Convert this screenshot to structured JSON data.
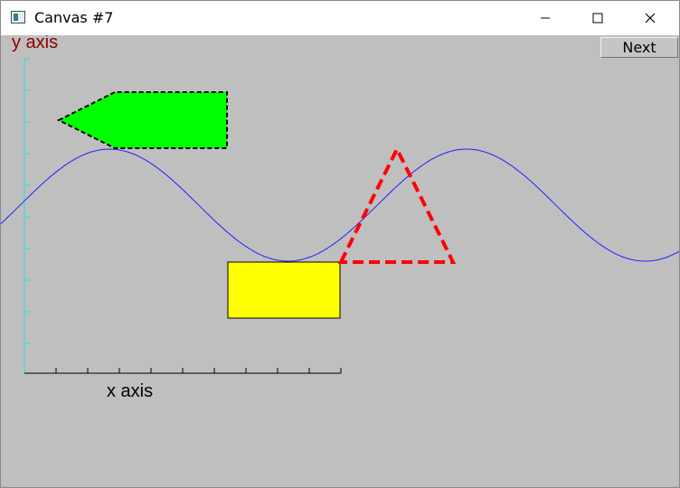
{
  "window": {
    "title": "Canvas #7",
    "controls": {
      "minimize_icon": "minimize-icon",
      "maximize_icon": "maximize-icon",
      "close_icon": "close-icon"
    }
  },
  "toolbar": {
    "next_label": "Next"
  },
  "canvas": {
    "y_axis_label": "y axis",
    "x_axis_label": "x axis",
    "colors": {
      "background": "#bfbfbf",
      "axis": "#20e0e0",
      "y_axis_label": "#8b0000",
      "wave": "#2020ff",
      "arrow_fill": "#00ff00",
      "rectangle_fill": "#ffff00",
      "triangle_stroke": "#ff0000"
    },
    "shapes": [
      "dashed green arrow polygon",
      "blue sine wave",
      "yellow rectangle",
      "dashed red triangle"
    ]
  }
}
